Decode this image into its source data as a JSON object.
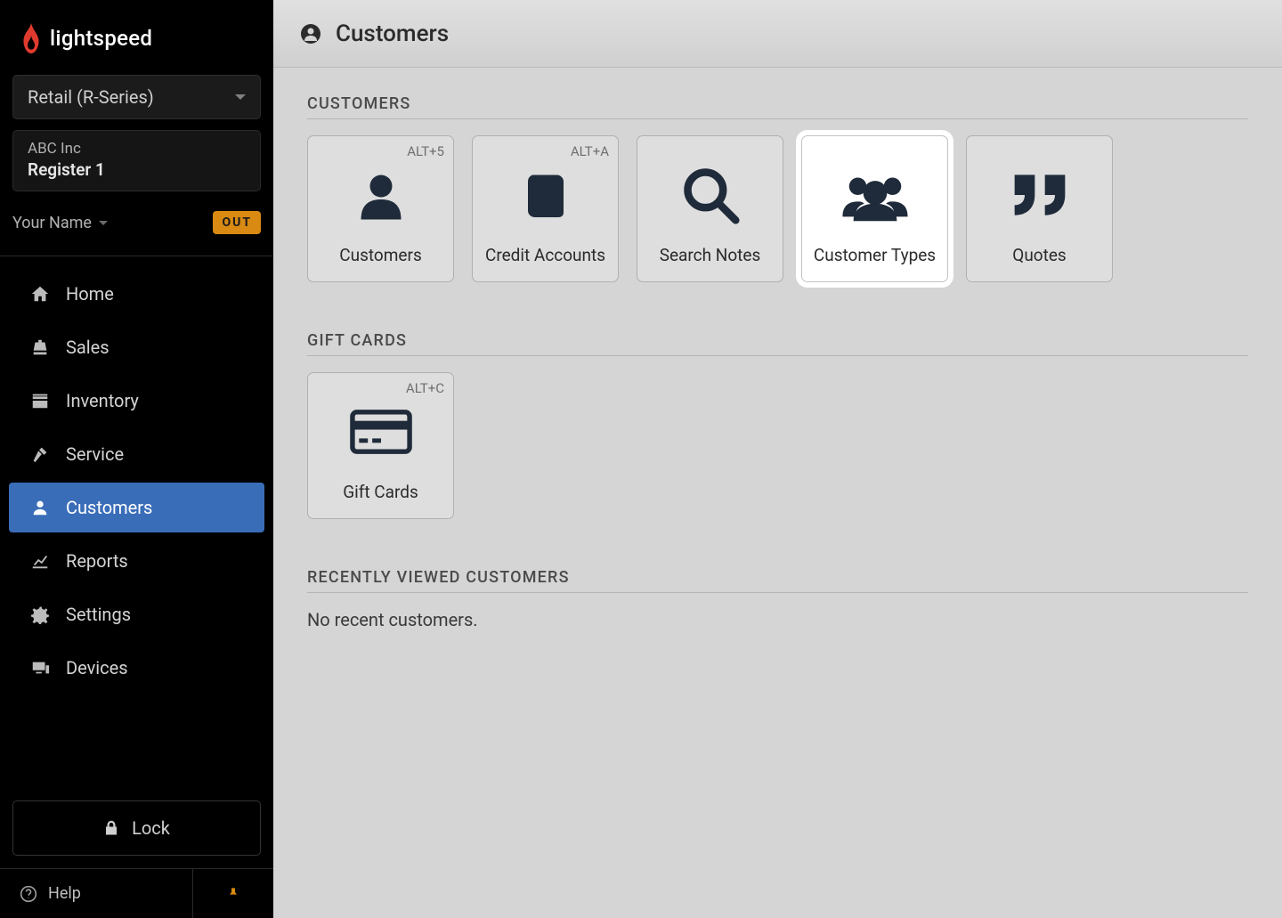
{
  "brand": "lightspeed",
  "product_selector": "Retail (R-Series)",
  "company": "ABC Inc",
  "register": "Register 1",
  "user_name": "Your Name",
  "out_badge": "OUT",
  "nav": {
    "home": "Home",
    "sales": "Sales",
    "inventory": "Inventory",
    "service": "Service",
    "customers": "Customers",
    "reports": "Reports",
    "settings": "Settings",
    "devices": "Devices"
  },
  "lock_label": "Lock",
  "help_label": "Help",
  "page_title": "Customers",
  "sections": {
    "customers": "CUSTOMERS",
    "gift_cards": "GIFT CARDS",
    "recent": "RECENTLY VIEWED CUSTOMERS"
  },
  "tiles": {
    "customers": {
      "label": "Customers",
      "shortcut": "ALT+5"
    },
    "credit_accounts": {
      "label": "Credit Accounts",
      "shortcut": "ALT+A"
    },
    "search_notes": {
      "label": "Search Notes"
    },
    "customer_types": {
      "label": "Customer Types"
    },
    "quotes": {
      "label": "Quotes"
    },
    "gift_cards": {
      "label": "Gift Cards",
      "shortcut": "ALT+C"
    }
  },
  "recent_empty": "No recent customers."
}
